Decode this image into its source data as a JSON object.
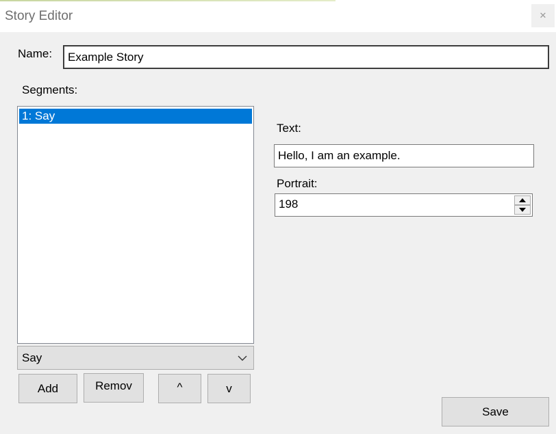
{
  "window": {
    "title": "Story Editor",
    "close_icon": "close-icon"
  },
  "name": {
    "label": "Name:",
    "value": "Example Story"
  },
  "segments": {
    "label": "Segments:",
    "items": [
      "1: Say"
    ],
    "selected_index": 0,
    "type_combo": {
      "value": "Say"
    },
    "buttons": {
      "add": "Add",
      "remove": "Remov",
      "up": "^",
      "down": "v"
    }
  },
  "text": {
    "label": "Text:",
    "value": "Hello, I am an example."
  },
  "portrait": {
    "label": "Portrait:",
    "value": "198"
  },
  "save_label": "Save",
  "colors": {
    "selection": "#0078d7",
    "background": "#f0f0f0"
  }
}
